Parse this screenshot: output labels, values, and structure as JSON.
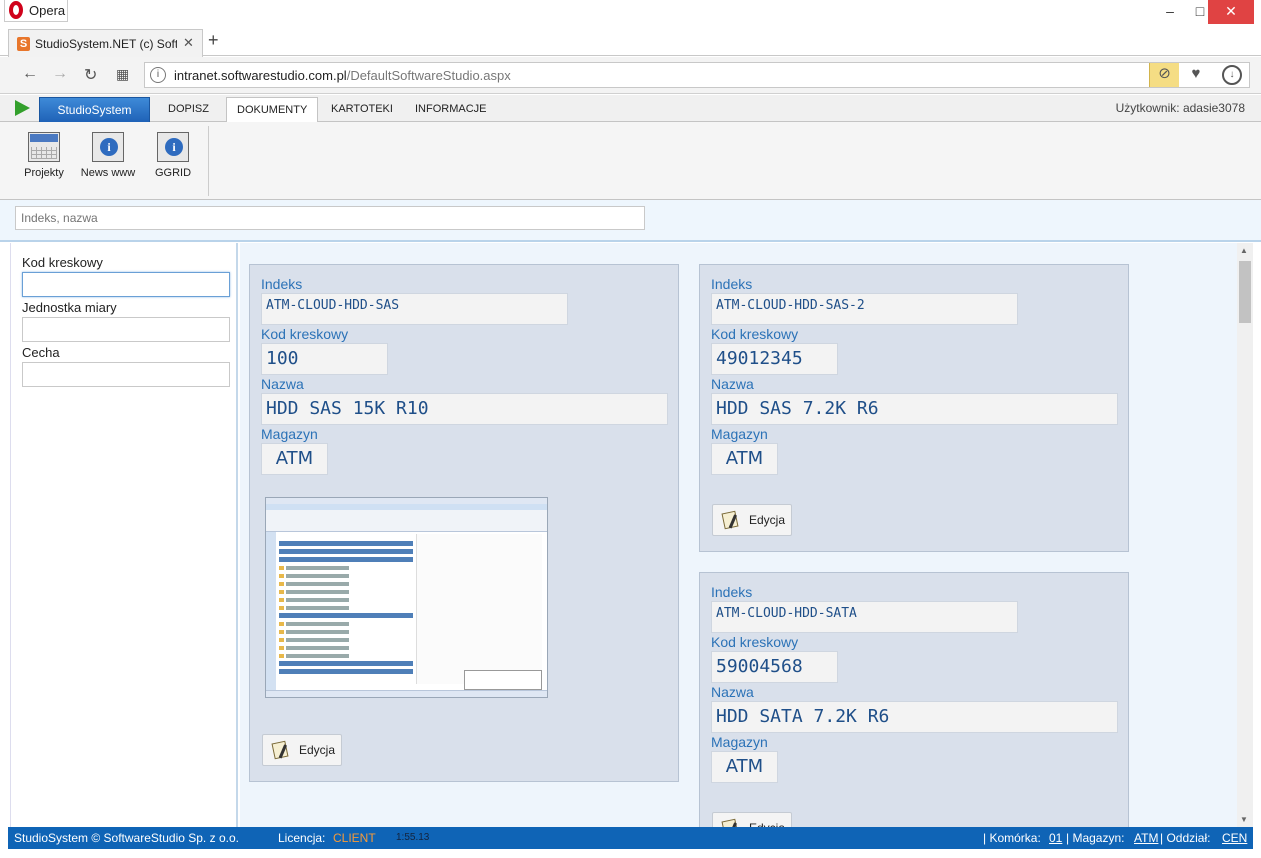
{
  "browser": {
    "app_name": "Opera",
    "tab_title": "StudioSystem.NET (c) Softwa",
    "url_host": "intranet.softwarestudio.com.pl",
    "url_path": "/DefaultSoftwareStudio.aspx",
    "win_min": "–",
    "win_max": "□",
    "win_close": "✕",
    "tab_close": "✕",
    "new_tab": "+"
  },
  "app": {
    "brand_button": "StudioSystem",
    "menu": [
      "DOPISZ",
      "DOKUMENTY",
      "KARTOTEKI",
      "INFORMACJE"
    ],
    "active_menu": "DOKUMENTY",
    "user": "Użytkownik: adasie3078",
    "ribbon": [
      "Projekty",
      "News www",
      "GGRID"
    ],
    "search_placeholder": "Indeks, nazwa"
  },
  "filters": {
    "barcode_label": "Kod kreskowy",
    "unit_label": "Jednostka miary",
    "feature_label": "Cecha"
  },
  "field_labels": {
    "index": "Indeks",
    "barcode": "Kod kreskowy",
    "name": "Nazwa",
    "warehouse": "Magazyn"
  },
  "edit_label": "Edycja",
  "products": [
    {
      "index": "ATM-CLOUD-HDD-SAS",
      "barcode": "100",
      "name": "HDD SAS 15K R10",
      "warehouse": "ATM"
    },
    {
      "index": "ATM-CLOUD-HDD-SAS-2",
      "barcode": "49012345",
      "name": "HDD SAS 7.2K R6",
      "warehouse": "ATM"
    },
    {
      "index": "ATM-CLOUD-HDD-SATA",
      "barcode": "59004568",
      "name": "HDD SATA 7.2K R6",
      "warehouse": "ATM"
    }
  ],
  "footer": {
    "copyright": "StudioSystem © SoftwareStudio Sp. z o.o.",
    "license_label": "Licencja:",
    "license_value": "CLIENT",
    "time": "1:55.13",
    "cell_label": "| Komórka:",
    "cell_value": "01",
    "warehouse_label": "| Magazyn:",
    "warehouse_value": "ATM",
    "branch_label": "| Oddział:",
    "branch_value": "CEN"
  },
  "colors": {
    "brand_blue": "#1f62b7",
    "footer_blue": "#0f64b6",
    "license_orange": "#f59a3a",
    "card_bg": "#d9e0eb",
    "field_label": "#2b72b7"
  }
}
